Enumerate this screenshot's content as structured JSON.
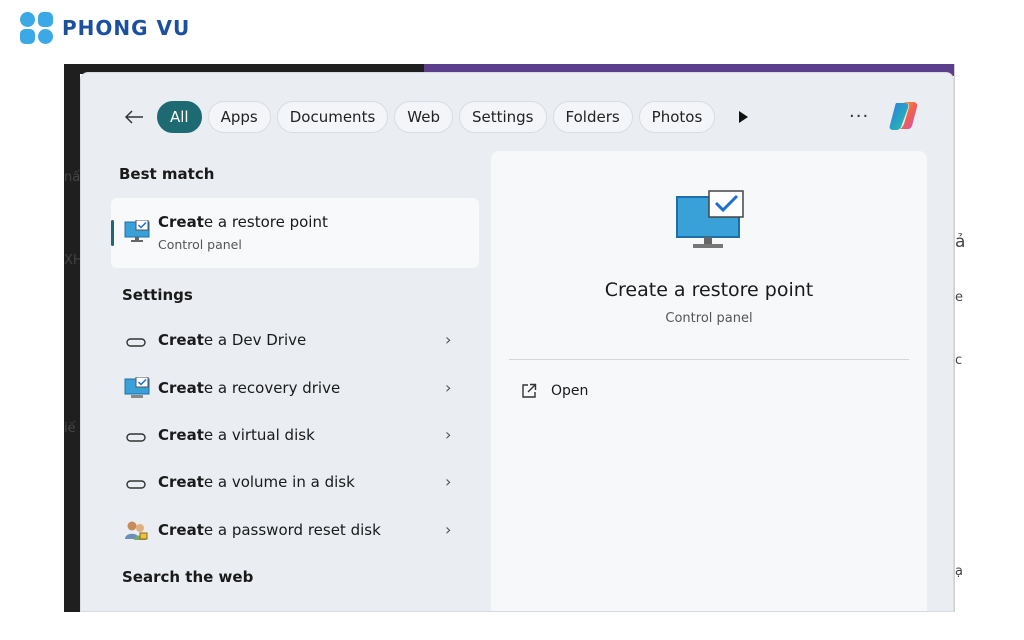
{
  "brand": {
    "name": "PHONG VU"
  },
  "search": {
    "filters": [
      {
        "label": "All",
        "active": true
      },
      {
        "label": "Apps"
      },
      {
        "label": "Documents"
      },
      {
        "label": "Web"
      },
      {
        "label": "Settings"
      },
      {
        "label": "Folders"
      },
      {
        "label": "Photos"
      }
    ],
    "more_label": "···"
  },
  "results": {
    "best_match_heading": "Best match",
    "best_match": {
      "bold": "Creat",
      "rest": "e a restore point",
      "sub": "Control panel",
      "icon": "restore-point-icon"
    },
    "settings_heading": "Settings",
    "settings_items": [
      {
        "bold": "Creat",
        "rest": "e a Dev Drive",
        "icon": "drive-icon"
      },
      {
        "bold": "Creat",
        "rest": "e a recovery drive",
        "icon": "recovery-drive-icon"
      },
      {
        "bold": "Creat",
        "rest": "e a virtual disk",
        "icon": "drive-icon"
      },
      {
        "bold": "Creat",
        "rest": "e a volume in a disk",
        "icon": "drive-icon"
      },
      {
        "bold": "Creat",
        "rest": "e a password reset disk",
        "icon": "users-icon"
      }
    ],
    "web_heading": "Search the web"
  },
  "preview": {
    "title": "Create a restore point",
    "subtitle": "Control panel",
    "open_label": "Open"
  },
  "background_glyphs": [
    "nấ",
    "XH",
    "iế",
    "ả",
    "e",
    "c",
    "ạ"
  ],
  "colors": {
    "accent": "#1e6a73",
    "brand_blue": "#1b4fa0",
    "logo_cyan": "#3ba9e6"
  }
}
